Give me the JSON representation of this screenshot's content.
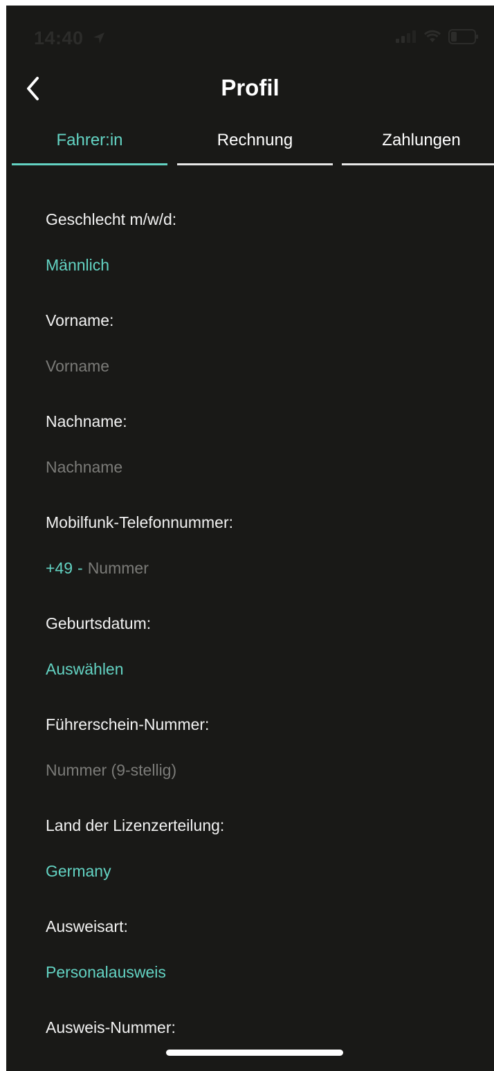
{
  "status_bar": {
    "time": "14:40",
    "location_icon": "location-arrow-icon",
    "signal_icon": "cellular-signal-icon",
    "wifi_icon": "wifi-icon",
    "battery_icon": "battery-icon"
  },
  "header": {
    "back_icon": "chevron-left-icon",
    "title": "Profil"
  },
  "tabs": [
    {
      "label": "Fahrer:in",
      "active": true
    },
    {
      "label": "Rechnung",
      "active": false
    },
    {
      "label": "Zahlungen",
      "active": false
    }
  ],
  "form": {
    "gender": {
      "label": "Geschlecht m/w/d:",
      "value": "Männlich"
    },
    "first_name": {
      "label": "Vorname:",
      "value": "",
      "placeholder": "Vorname"
    },
    "last_name": {
      "label": "Nachname:",
      "value": "",
      "placeholder": "Nachname"
    },
    "phone": {
      "label": "Mobilfunk-Telefonnummer:",
      "country_code": "+49",
      "separator": "-",
      "value": "",
      "placeholder": "Nummer"
    },
    "birthdate": {
      "label": "Geburtsdatum:",
      "value": "Auswählen"
    },
    "license_number": {
      "label": "Führerschein-Nummer:",
      "value": "",
      "placeholder": "Nummer (9-stellig)"
    },
    "license_country": {
      "label": "Land der Lizenzerteilung:",
      "value": "Germany"
    },
    "id_type": {
      "label": "Ausweisart:",
      "value": "Personalausweis"
    },
    "id_number": {
      "label": "Ausweis-Nummer:"
    }
  },
  "colors": {
    "background": "#191917",
    "accent": "#63d3c3",
    "text": "#f2f2f2",
    "placeholder": "#7b7b78"
  }
}
